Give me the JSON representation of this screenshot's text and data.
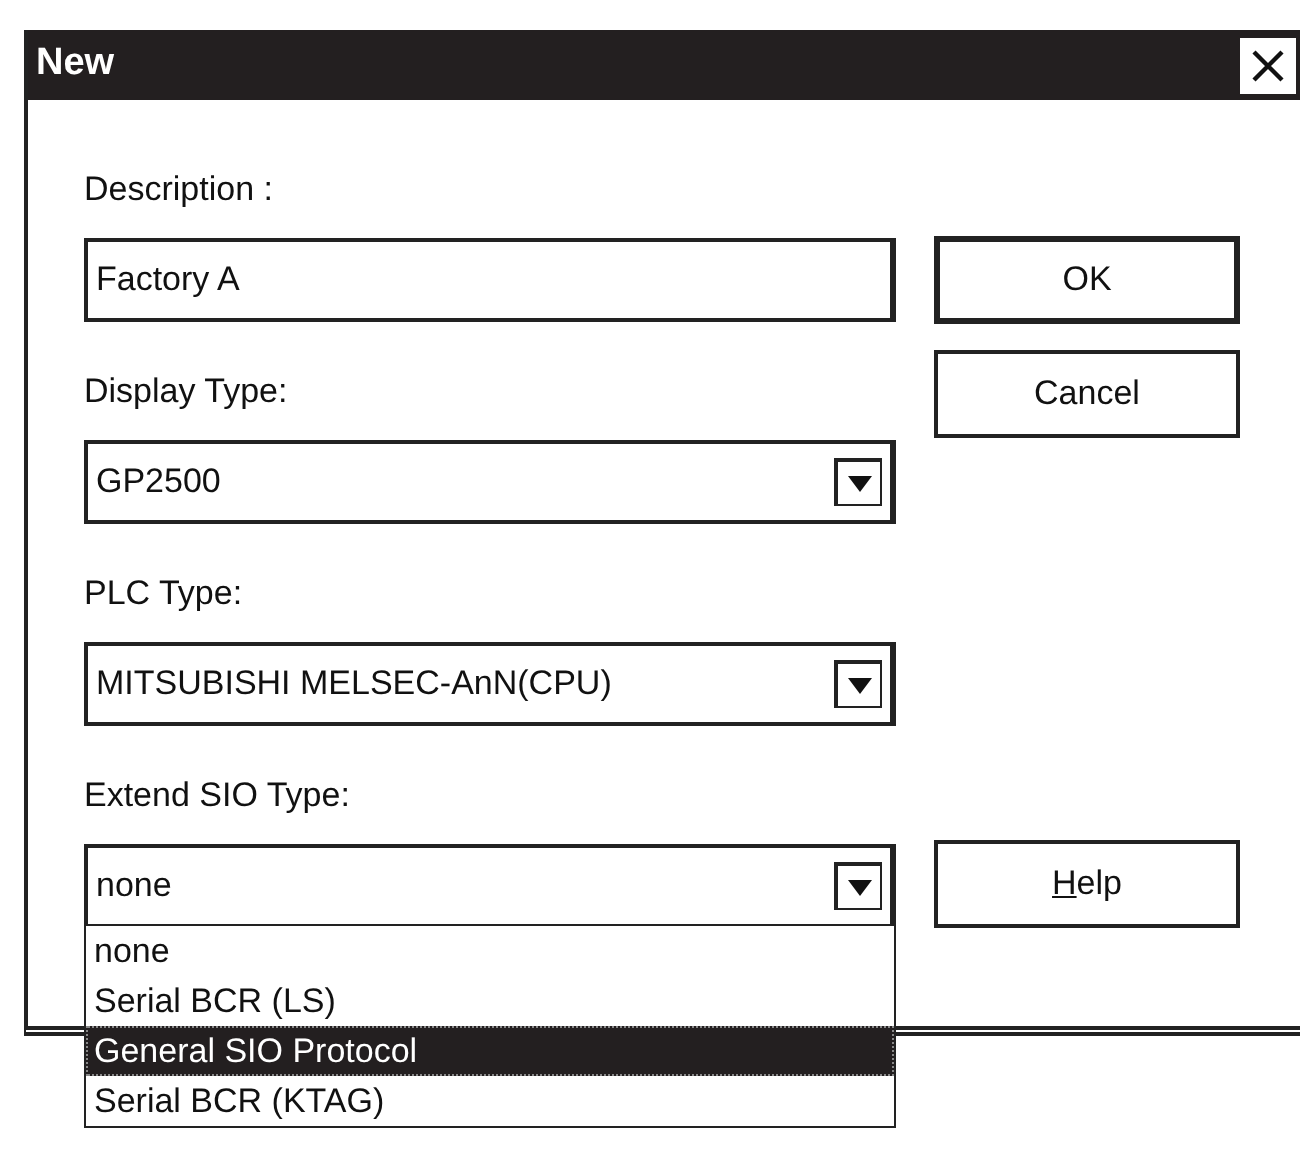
{
  "window": {
    "title": "New"
  },
  "fields": [
    {
      "kind": "text",
      "label": "Description :",
      "value": "Factory A"
    },
    {
      "kind": "combo",
      "label": "Display Type:",
      "value": "GP2500"
    },
    {
      "kind": "combo",
      "label": "PLC Type:",
      "value": "MITSUBISHI MELSEC-AnN(CPU)"
    },
    {
      "kind": "combo",
      "label": "Extend SIO Type:",
      "value": "none",
      "expanded": true,
      "options": [
        {
          "label": "none",
          "highlighted": false
        },
        {
          "label": "Serial BCR (LS)",
          "highlighted": false
        },
        {
          "label": "General SIO Protocol",
          "highlighted": true
        },
        {
          "label": "Serial BCR (KTAG)",
          "highlighted": false
        }
      ]
    }
  ],
  "buttons": [
    {
      "label": "OK",
      "bottom_aligned": false,
      "default": true,
      "mnemonic_underlined": false
    },
    {
      "label": "Cancel",
      "bottom_aligned": false,
      "default": false,
      "mnemonic_underlined": false
    },
    {
      "label": "Help",
      "bottom_aligned": true,
      "default": false,
      "mnemonic_underlined": true
    }
  ]
}
